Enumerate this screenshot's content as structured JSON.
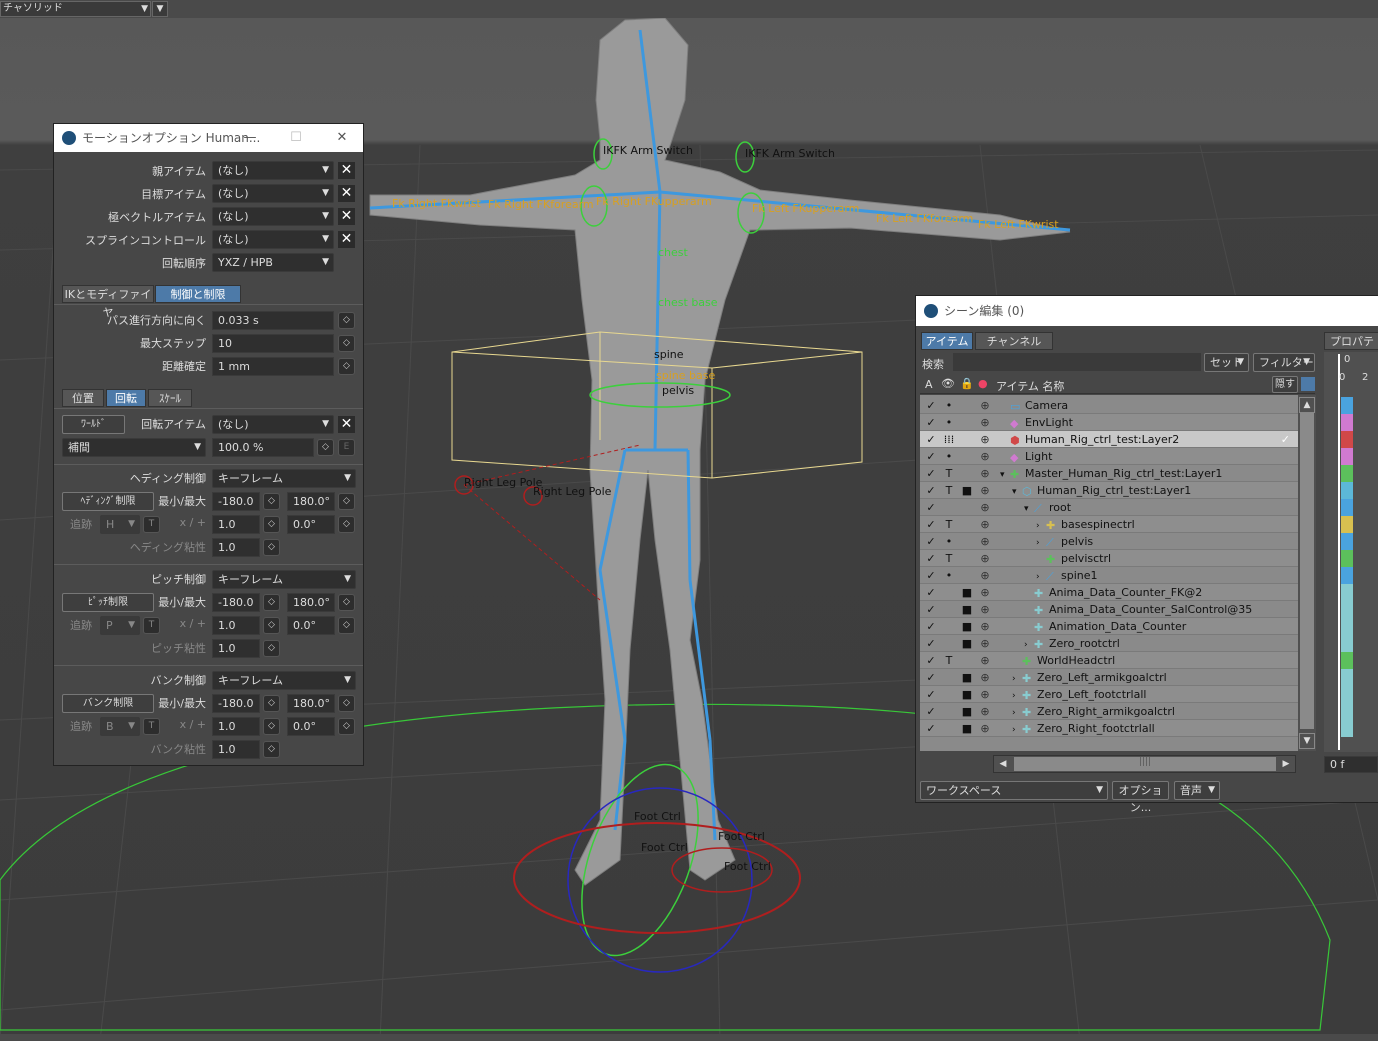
{
  "viewport": {
    "camera_select": "チャソリッド",
    "labels": {
      "ikfk_left": "IKFK Arm Switch",
      "ikfk_right": "IKFK Arm Switch",
      "fk_right_wrist": "Fk  Right  FKwrist",
      "fk_right_forearm": "Fk  Right  FKforearm",
      "fk_right_upperarm": "Fk  Right  FKupperarm",
      "fk_left_upperarm": "Fk  Left  FKupperarm",
      "fk_left_forearm": "Fk  Left  FKforearm",
      "fk_left_wrist": "Fk  Left  FKwrist",
      "chest": "chest",
      "chest_base": "chest base",
      "spine": "spine",
      "spine_base": "spine base",
      "pelvis": "pelvis",
      "right_leg_pole_1": "Right Leg Pole",
      "right_leg_pole_2": "Right Leg Pole",
      "foot_ctrl_1": "Foot Ctrl",
      "foot_ctrl_2": "Foot Ctrl",
      "foot_ctrl_3": "Foot Ctrl",
      "foot_ctrl_4": "Foot Ctrl"
    }
  },
  "motion_panel": {
    "title": "モーションオプション Human...",
    "parent_item_label": "親アイテム",
    "parent_item_value": "(なし)",
    "target_item_label": "目標アイテム",
    "target_item_value": "(なし)",
    "pole_vector_label": "極ベクトルアイテム",
    "pole_vector_value": "(なし)",
    "spline_control_label": "スプラインコントロール",
    "spline_control_value": "(なし)",
    "rotation_order_label": "回転順序",
    "rotation_order_value": "YXZ / HPB",
    "tabs": [
      "IKとモディファイヤ",
      "制御と制限"
    ],
    "active_tab": 1,
    "path_align_label": "パス進行方向に向く",
    "path_align_value": "0.033 s",
    "max_steps_label": "最大ステップ",
    "max_steps_value": "10",
    "distance_label": "距離確定",
    "distance_value": "1 mm",
    "subtabs": [
      "位置",
      "回転",
      "ｽｹｰﾙ"
    ],
    "active_subtab": 1,
    "world_button": "ﾜｰﾙﾄﾞ",
    "rotation_item_label": "回転アイテム",
    "rotation_item_value": "(なし)",
    "interp_value": "補間",
    "interp_percent": "100.0 %",
    "e_button": "E",
    "heading": {
      "control_label": "ヘディング制御",
      "control_value": "キーフレーム",
      "limit_button": "ﾍﾃﾞｨﾝｸﾞ制限",
      "minmax_label": "最小/最大",
      "min": "-180.0",
      "max": "180.0°",
      "track_label": "追跡",
      "track_axis": "H",
      "t_button": "T",
      "xplus_label": "x / +",
      "mult": "1.0",
      "offset": "0.0°",
      "viscosity_label": "ヘディング粘性",
      "viscosity": "1.0"
    },
    "pitch": {
      "control_label": "ピッチ制御",
      "control_value": "キーフレーム",
      "limit_button": "ﾋﾟｯﾁ制限",
      "minmax_label": "最小/最大",
      "min": "-180.0",
      "max": "180.0°",
      "track_label": "追跡",
      "track_axis": "P",
      "t_button": "T",
      "xplus_label": "x / +",
      "mult": "1.0",
      "offset": "0.0°",
      "viscosity_label": "ピッチ粘性",
      "viscosity": "1.0"
    },
    "bank": {
      "control_label": "バンク制御",
      "control_value": "キーフレーム",
      "limit_button": "バンク制限",
      "minmax_label": "最小/最大",
      "min": "-180.0",
      "max": "180.0°",
      "track_label": "追跡",
      "track_axis": "B",
      "t_button": "T",
      "xplus_label": "x / +",
      "mult": "1.0",
      "offset": "0.0°",
      "viscosity_label": "バンク粘性",
      "viscosity": "1.0"
    }
  },
  "scene_panel": {
    "title": "シーン編集 (0)",
    "tabs": [
      "アイテム",
      "チャンネル"
    ],
    "properties_tab": "プロパティ",
    "search_label": "検索",
    "set_button": "セット",
    "filter_button": "フィルター",
    "col_a": "A",
    "col_name": "アイテム 名称",
    "hide_button": "隠す",
    "timeline_ticks": [
      "0",
      "0",
      "2"
    ],
    "frame_value": "0 f",
    "workspace_select": "ワークスペース",
    "options_button": "オプション...",
    "audio_select": "音声",
    "items": [
      {
        "name": "Camera",
        "indent": 0,
        "vis": "•",
        "lock": "",
        "arrow": "",
        "color": "#4aa3df",
        "icon": "camera"
      },
      {
        "name": "EnvLight",
        "indent": 0,
        "vis": "•",
        "lock": "",
        "arrow": "",
        "color": "#d07ad0",
        "icon": "light"
      },
      {
        "name": "Human_Rig_ctrl_test:Layer2",
        "indent": 0,
        "vis": "⁞⁞⁞",
        "lock": "",
        "arrow": "",
        "color": "#d04848",
        "icon": "mesh",
        "selected": true
      },
      {
        "name": "Light",
        "indent": 0,
        "vis": "•",
        "lock": "",
        "arrow": "",
        "color": "#d07ad0",
        "icon": "light"
      },
      {
        "name": "Master_Human_Rig_ctrl_test:Layer1",
        "indent": 0,
        "vis": "T",
        "lock": "",
        "arrow": "v",
        "color": "#5cc05c",
        "icon": "null"
      },
      {
        "name": "Human_Rig_ctrl_test:Layer1",
        "indent": 1,
        "vis": "T",
        "lock": "🔒",
        "arrow": "v",
        "color": "#5cb8d8",
        "icon": "mesh2"
      },
      {
        "name": "root",
        "indent": 2,
        "vis": "",
        "lock": "",
        "arrow": "v",
        "color": "#4aa3df",
        "icon": "bone"
      },
      {
        "name": "basespinectrl",
        "indent": 3,
        "vis": "T",
        "lock": "",
        "arrow": ">",
        "color": "#d8c050",
        "icon": "nully"
      },
      {
        "name": "pelvis",
        "indent": 3,
        "vis": "•",
        "lock": "",
        "arrow": ">",
        "color": "#4aa3df",
        "icon": "bone"
      },
      {
        "name": "pelvisctrl",
        "indent": 3,
        "vis": "T",
        "lock": "",
        "arrow": "",
        "color": "#5cc05c",
        "icon": "null"
      },
      {
        "name": "spine1",
        "indent": 3,
        "vis": "•",
        "lock": "",
        "arrow": ">",
        "color": "#4aa3df",
        "icon": "bone"
      },
      {
        "name": "Anima_Data_Counter_FK@2",
        "indent": 2,
        "vis": "",
        "lock": "🔒",
        "arrow": "",
        "color": "#88ccd0",
        "icon": "nullc"
      },
      {
        "name": "Anima_Data_Counter_SalControl@35",
        "indent": 2,
        "vis": "",
        "lock": "🔒",
        "arrow": "",
        "color": "#88ccd0",
        "icon": "nullc"
      },
      {
        "name": "Animation_Data_Counter",
        "indent": 2,
        "vis": "",
        "lock": "🔒",
        "arrow": "",
        "color": "#88ccd0",
        "icon": "nullc"
      },
      {
        "name": "Zero_rootctrl",
        "indent": 2,
        "vis": "",
        "lock": "🔒",
        "arrow": ">",
        "color": "#88ccd0",
        "icon": "nullc"
      },
      {
        "name": "WorldHeadctrl",
        "indent": 1,
        "vis": "T",
        "lock": "",
        "arrow": "",
        "color": "#5cc05c",
        "icon": "null"
      },
      {
        "name": "Zero_Left_armikgoalctrl",
        "indent": 1,
        "vis": "",
        "lock": "🔒",
        "arrow": ">",
        "color": "#88ccd0",
        "icon": "nullc"
      },
      {
        "name": "Zero_Left_footctrlall",
        "indent": 1,
        "vis": "",
        "lock": "🔒",
        "arrow": ">",
        "color": "#88ccd0",
        "icon": "nullc"
      },
      {
        "name": "Zero_Right_armikgoalctrl",
        "indent": 1,
        "vis": "",
        "lock": "🔒",
        "arrow": ">",
        "color": "#88ccd0",
        "icon": "nullc"
      },
      {
        "name": "Zero_Right_footctrlall",
        "indent": 1,
        "vis": "",
        "lock": "🔒",
        "arrow": ">",
        "color": "#88ccd0",
        "icon": "nullc"
      }
    ]
  }
}
